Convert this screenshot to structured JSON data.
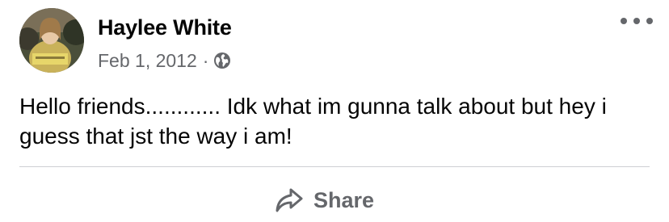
{
  "post": {
    "author": "Haylee White",
    "date": "Feb 1, 2012",
    "separator": "·",
    "audience_icon": "globe-icon",
    "menu_icon": "more-options-icon",
    "text": "Hello friends............ Idk what im gunna talk about but hey i guess that jst the way i am!"
  },
  "actions": {
    "share_label": "Share",
    "share_icon": "share-arrow-icon"
  },
  "colors": {
    "primary_text": "#050505",
    "secondary_text": "#65676b",
    "divider": "#ced0d4"
  }
}
